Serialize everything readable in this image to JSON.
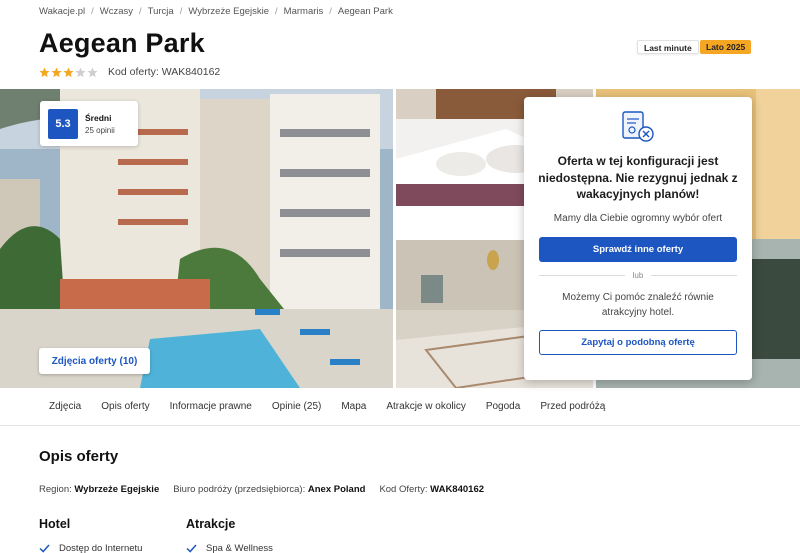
{
  "breadcrumb": [
    "Wakacje.pl",
    "Wczasy",
    "Turcja",
    "Wybrzeże Egejskie",
    "Marmaris",
    "Aegean Park"
  ],
  "title": "Aegean Park",
  "stars": {
    "filled": 3,
    "total": 5,
    "color": "#f5a623",
    "empty_color": "#cfcfcf"
  },
  "offer_code_label": "Kod oferty: WAK840162",
  "tags": {
    "last_minute": "Last minute",
    "season": "Lato 2025"
  },
  "score": {
    "value": "5.3",
    "label": "Średni",
    "count": "25 opinii",
    "color": "#1d56c1"
  },
  "photos_button": "Zdjęcia oferty (10)",
  "modal": {
    "title": "Oferta w tej konfiguracji jest niedostępna. Nie rezygnuj jednak z wakacyjnych planów!",
    "subtitle": "Mamy dla Ciebie ogromny wybór ofert",
    "primary_button": "Sprawdź inne oferty",
    "divider": "lub",
    "help_text": "Możemy Ci pomóc znaleźć równie atrakcyjny hotel.",
    "secondary_button": "Zapytaj o podobną ofertę"
  },
  "tabs": [
    "Zdjęcia",
    "Opis oferty",
    "Informacje prawne",
    "Opinie (25)",
    "Mapa",
    "Atrakcje w okolicy",
    "Pogoda",
    "Przed podróżą"
  ],
  "section_title": "Opis oferty",
  "facts": [
    {
      "label": "Region:",
      "value": "Wybrzeże Egejskie"
    },
    {
      "label": "Biuro podróży (przedsiębiorca):",
      "value": "Anex Poland"
    },
    {
      "label": "Kod Oferty:",
      "value": "WAK840162"
    }
  ],
  "hotel": {
    "title": "Hotel",
    "features": [
      "Dostęp do Internetu"
    ]
  },
  "attractions": {
    "title": "Atrakcje",
    "features": [
      "Spa & Wellness"
    ]
  },
  "colors": {
    "accent": "#1d56c1",
    "tag_season": "#f5a623"
  }
}
